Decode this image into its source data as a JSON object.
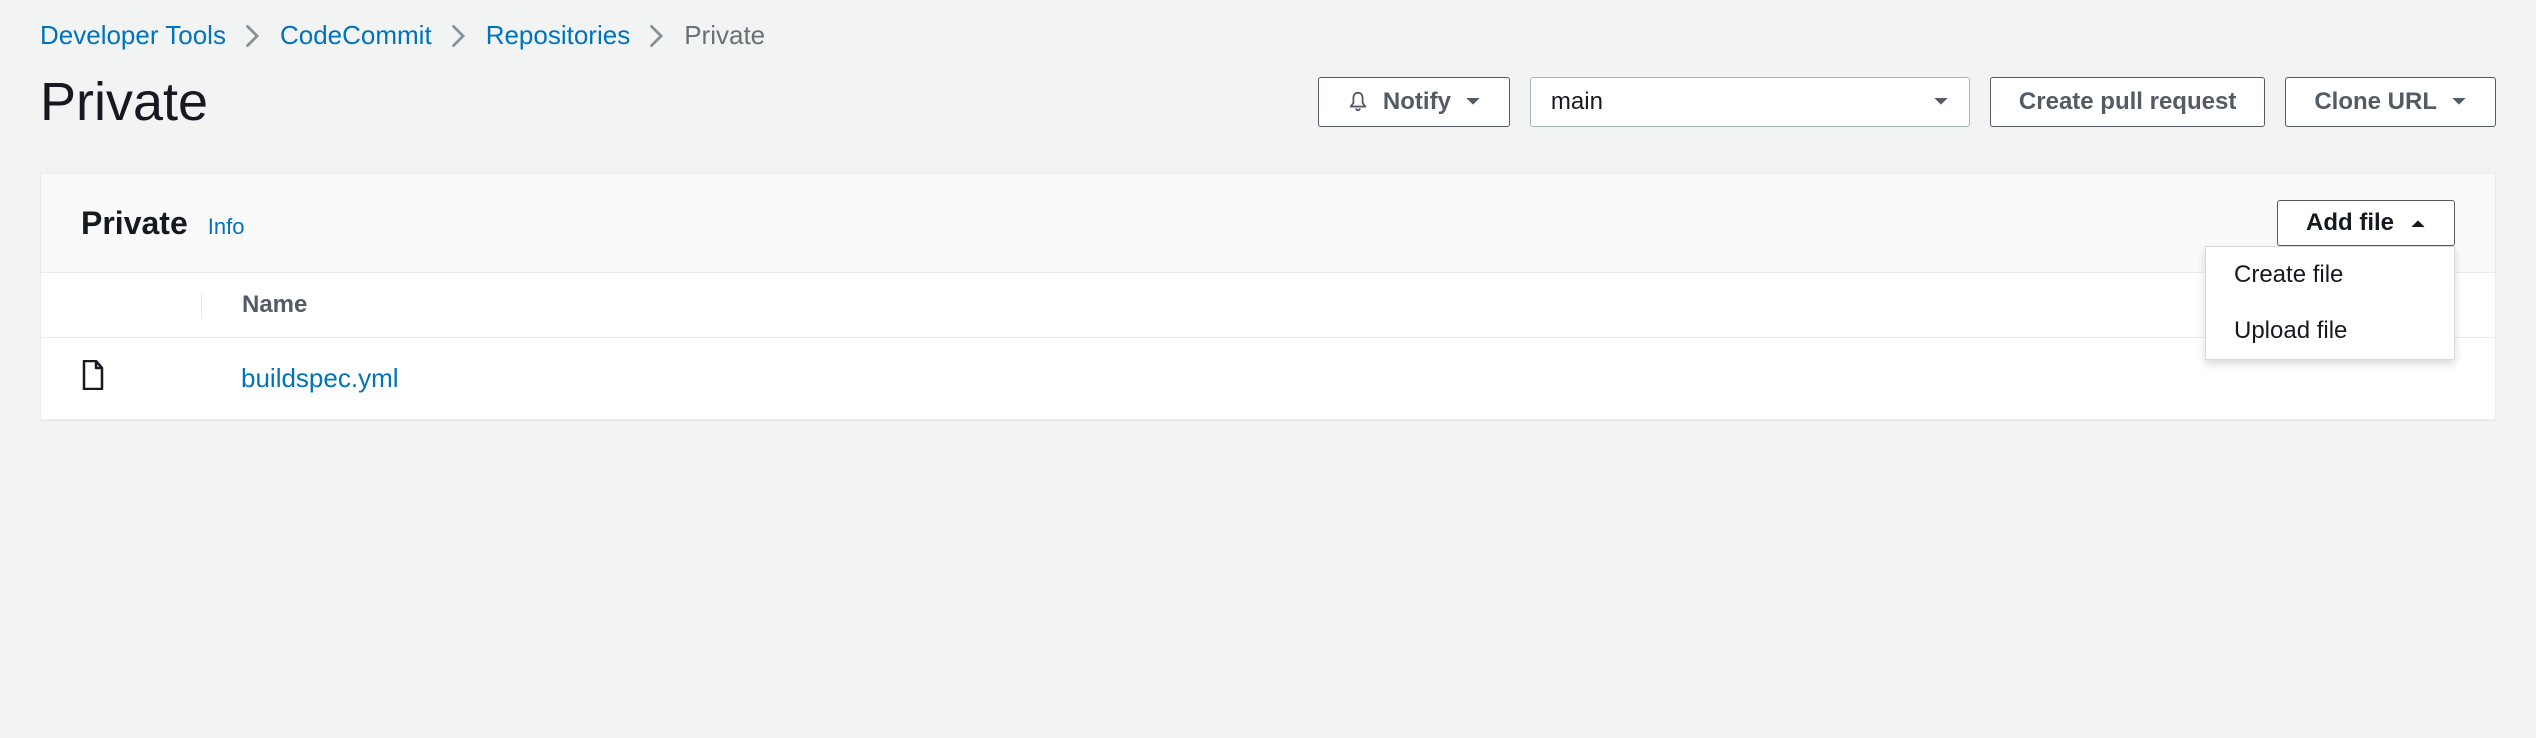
{
  "breadcrumb": {
    "items": [
      "Developer Tools",
      "CodeCommit",
      "Repositories"
    ],
    "current": "Private"
  },
  "header": {
    "title": "Private",
    "notify_label": "Notify",
    "branch": "main",
    "create_pr_label": "Create pull request",
    "clone_label": "Clone URL"
  },
  "panel": {
    "title": "Private",
    "info_label": "Info",
    "add_file_label": "Add file",
    "dropdown": {
      "create": "Create file",
      "upload": "Upload file"
    }
  },
  "table": {
    "col_name": "Name",
    "rows": [
      {
        "name": "buildspec.yml"
      }
    ]
  }
}
